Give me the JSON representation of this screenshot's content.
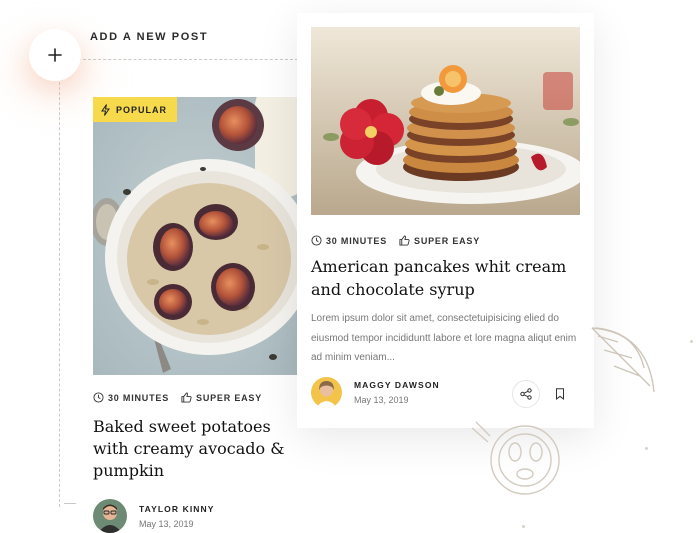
{
  "add_post": {
    "label": "ADD A NEW POST",
    "icon": "plus-icon"
  },
  "posts": [
    {
      "badge": "POPULAR",
      "badge_icon": "lightning-icon",
      "time": "30 MINUTES",
      "difficulty": "SUPER EASY",
      "title": "Baked sweet potatoes with creamy avocado & pumpkin",
      "author": {
        "name": "TAYLOR KINNY",
        "date": "May 13, 2019"
      }
    },
    {
      "time": "30 MINUTES",
      "difficulty": "SUPER EASY",
      "title": "American pancakes whit cream and chocolate syrup",
      "excerpt": "Lorem ipsum dolor sit amet, consectetuipisicing elied do eiusmod tempor incididuntt labore et lore magna aliqut enim ad minim veniam...",
      "author": {
        "name": "MAGGY DAWSON",
        "date": "May 13, 2019"
      },
      "actions": [
        "share-icon",
        "bookmark-icon"
      ]
    }
  ],
  "colors": {
    "badge": "#f7d94c",
    "text": "#222222",
    "muted": "#777777",
    "dashed": "#c9c9c9"
  }
}
